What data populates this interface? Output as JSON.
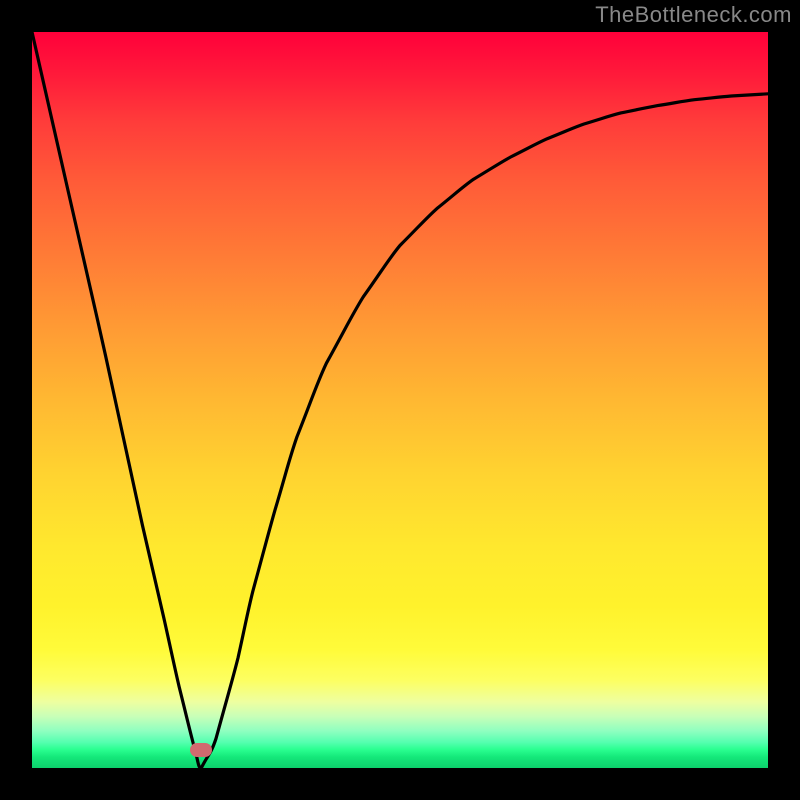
{
  "attribution": "TheBottleneck.com",
  "chart_data": {
    "type": "line",
    "title": "",
    "xlabel": "",
    "ylabel": "",
    "xlim": [
      0,
      100
    ],
    "ylim": [
      0,
      100
    ],
    "x": [
      0,
      5,
      10,
      15,
      18,
      20,
      22,
      23,
      25,
      28,
      30,
      33,
      36,
      40,
      45,
      50,
      55,
      60,
      65,
      70,
      75,
      80,
      85,
      90,
      95,
      100
    ],
    "values": [
      100,
      78,
      56,
      33,
      20,
      11,
      3,
      0,
      4,
      15,
      24,
      35,
      45,
      55,
      64,
      71,
      76,
      80,
      83,
      85.5,
      87.5,
      89,
      90,
      90.8,
      91.3,
      91.6
    ],
    "marker": {
      "x": 23,
      "y": 2.5
    }
  },
  "colors": {
    "curve": "#000000",
    "marker": "#d16a6f"
  }
}
